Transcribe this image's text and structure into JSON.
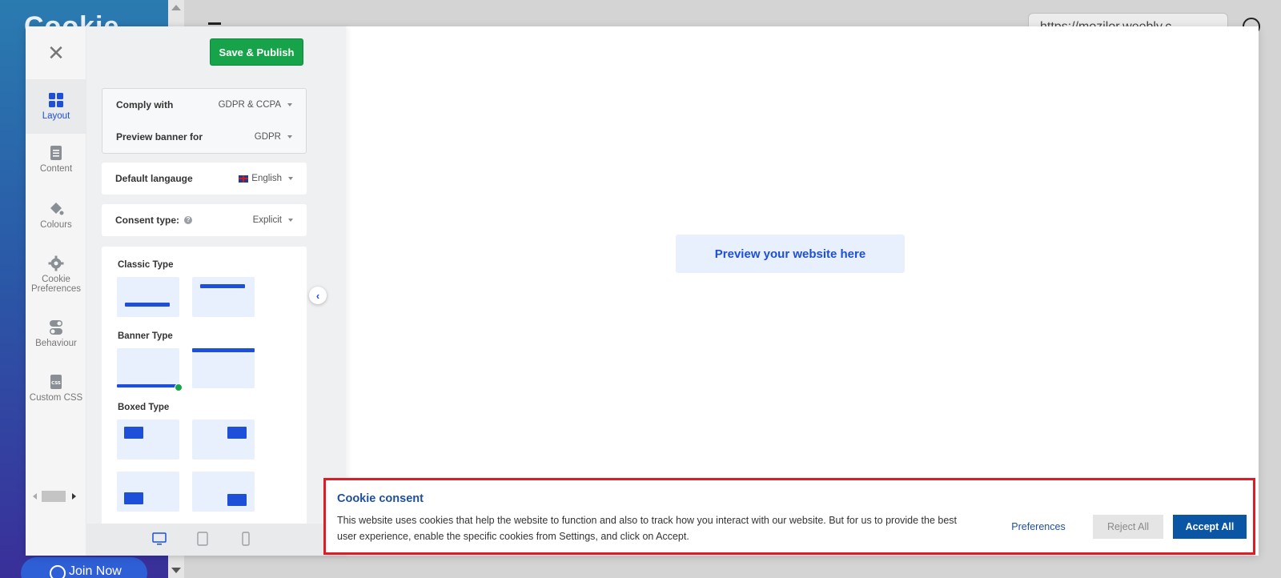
{
  "background": {
    "url_text": "https://mozilor.weebly.c",
    "join_label": "Join Now"
  },
  "rail": {
    "close_icon": "close-icon",
    "items": [
      {
        "label": "Layout",
        "icon": "grid-icon",
        "active": true
      },
      {
        "label": "Content",
        "icon": "document-icon",
        "active": false
      },
      {
        "label": "Colours",
        "icon": "paint-bucket-icon",
        "active": false
      },
      {
        "label": "Cookie Preferences",
        "icon": "gear-icon",
        "active": false
      },
      {
        "label": "Behaviour",
        "icon": "toggle-icon",
        "active": false
      },
      {
        "label": "Custom CSS",
        "icon": "css-file-icon",
        "active": false
      }
    ]
  },
  "panel": {
    "save_label": "Save & Publish",
    "comply_label": "Comply with",
    "comply_value": "GDPR & CCPA",
    "preview_for_label": "Preview banner for",
    "preview_for_value": "GDPR",
    "language_label": "Default langauge",
    "language_value": "English",
    "consent_label": "Consent type:",
    "consent_value": "Explicit",
    "classic_title": "Classic Type",
    "banner_title": "Banner Type",
    "boxed_title": "Boxed Type"
  },
  "preview": {
    "placeholder": "Preview your website here"
  },
  "cookie_banner": {
    "title": "Cookie consent",
    "text": "This website uses cookies that help the website to function and also to track how you interact with our website. But for us to provide the best user experience, enable the specific cookies from Settings, and click on Accept.",
    "preferences_label": "Preferences",
    "reject_label": "Reject All",
    "accept_label": "Accept All"
  },
  "colors": {
    "accent": "#1e4fd8",
    "save_green": "#16a34a",
    "accept_blue": "#0b56a4",
    "highlight_red": "#e01b24"
  }
}
